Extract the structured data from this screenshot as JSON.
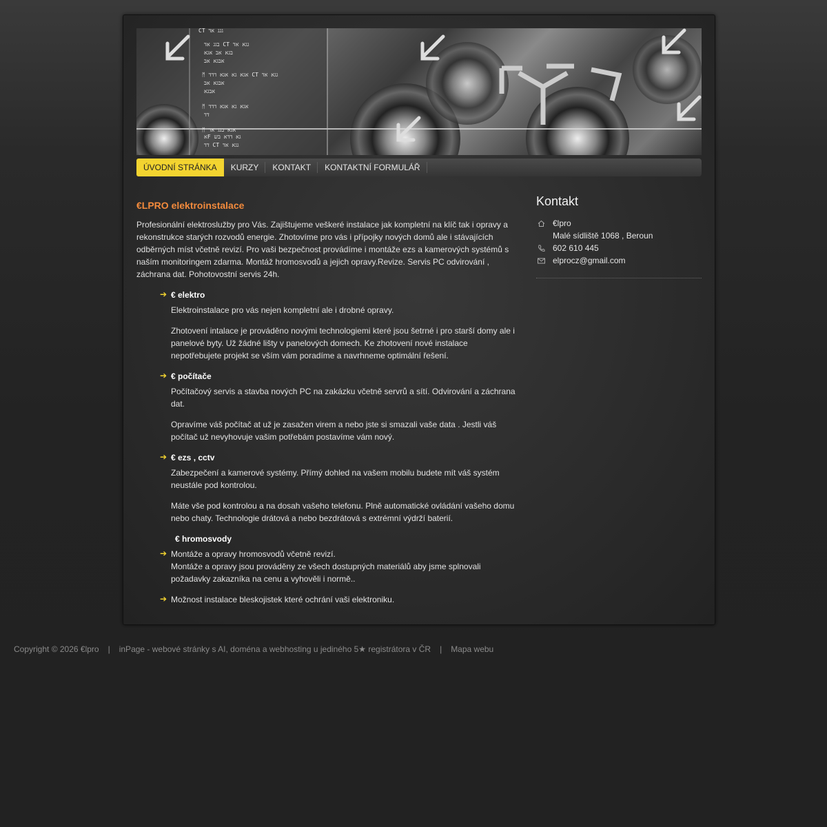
{
  "nav": {
    "items": [
      {
        "label": "ÚVODNÍ STRÁNKA",
        "active": true
      },
      {
        "label": "KURZY",
        "active": false
      },
      {
        "label": "KONTAKT",
        "active": false
      },
      {
        "label": "KONTAKTNÍ FORMULÁŘ",
        "active": false
      }
    ]
  },
  "main": {
    "title": "€LPRO elektroinstalace",
    "intro": "Profesionální elektroslužby pro Vás. Zajištujeme veškeré instalace jak kompletní na klíč tak i opravy a rekonstrukce starých rozvodů energie. Zhotovíme pro vás i přípojky nových domů ale i stávajících odběrných míst včetně revizí. Pro vaši bezpečnost provádíme i montáže ezs a kamerových systémů s naším monitoringem zdarma. Montáž hromosvodů a jejich opravy.Revize. Servis PC odvirování , záchrana dat. Pohotovostní servis 24h.",
    "services": [
      {
        "title": "€ elektro",
        "paragraphs": [
          "Elektroinstalace pro vás nejen kompletní ale i drobné opravy.",
          "Zhotovení intalace je prováděno novými technologiemi které jsou šetrné i pro starší domy ale i panelové byty. Už žádné lišty v panelových domech. Ke zhotovení nové instalace nepotřebujete projekt se vším vám poradíme a navrhneme optimální řešení."
        ]
      },
      {
        "title": "€ počítače",
        "paragraphs": [
          "Počítačový servis a stavba nových PC na zakázku včetně servrů a sítí. Odvirování a záchrana dat.",
          "Opravíme váš počítač at už je zasažen virem a nebo jste si smazali vaše data . Jestli váš počítač už nevyhovuje vašim potřebám postavíme vám nový."
        ]
      },
      {
        "title": "€ ezs , cctv",
        "paragraphs": [
          "Zabezpečení a kamerové systémy. Přímý dohled na vašem mobilu budete mít váš systém neustále pod kontrolou.",
          "Máte vše pod kontrolou a na dosah vašeho telefonu. Plně automatické ovládání vašeho domu nebo chaty. Technologie drátová a nebo bezdrátová s extrémní výdrží baterií."
        ]
      }
    ],
    "hromosvody": {
      "title": "€ hromosvody",
      "item1": "Montáže a opravy hromosvodů včetně revizí.",
      "item1b": "Montáže a opravy jsou prováděny ze všech dostupných materiálů aby jsme splnovali požadavky zakazníka na cenu a vyhověli i normě..",
      "item2": "Možnost instalace bleskojistek které ochrání vaši elektroniku."
    }
  },
  "sidebar": {
    "title": "Kontakt",
    "name": "€lpro",
    "address": "Malé sídliště 1068 , Beroun",
    "phone": "602 610 445",
    "email": "elprocz@gmail.com"
  },
  "footer": {
    "copyright": "Copyright © 2026 €lpro",
    "sep": "|",
    "inpage": "inPage - webové stránky s AI, doména a webhosting u jediného 5★ registrátora v ČR",
    "sitemap": "Mapa webu"
  },
  "colors": {
    "accent": "#f3d430",
    "title": "#f28a3c"
  }
}
